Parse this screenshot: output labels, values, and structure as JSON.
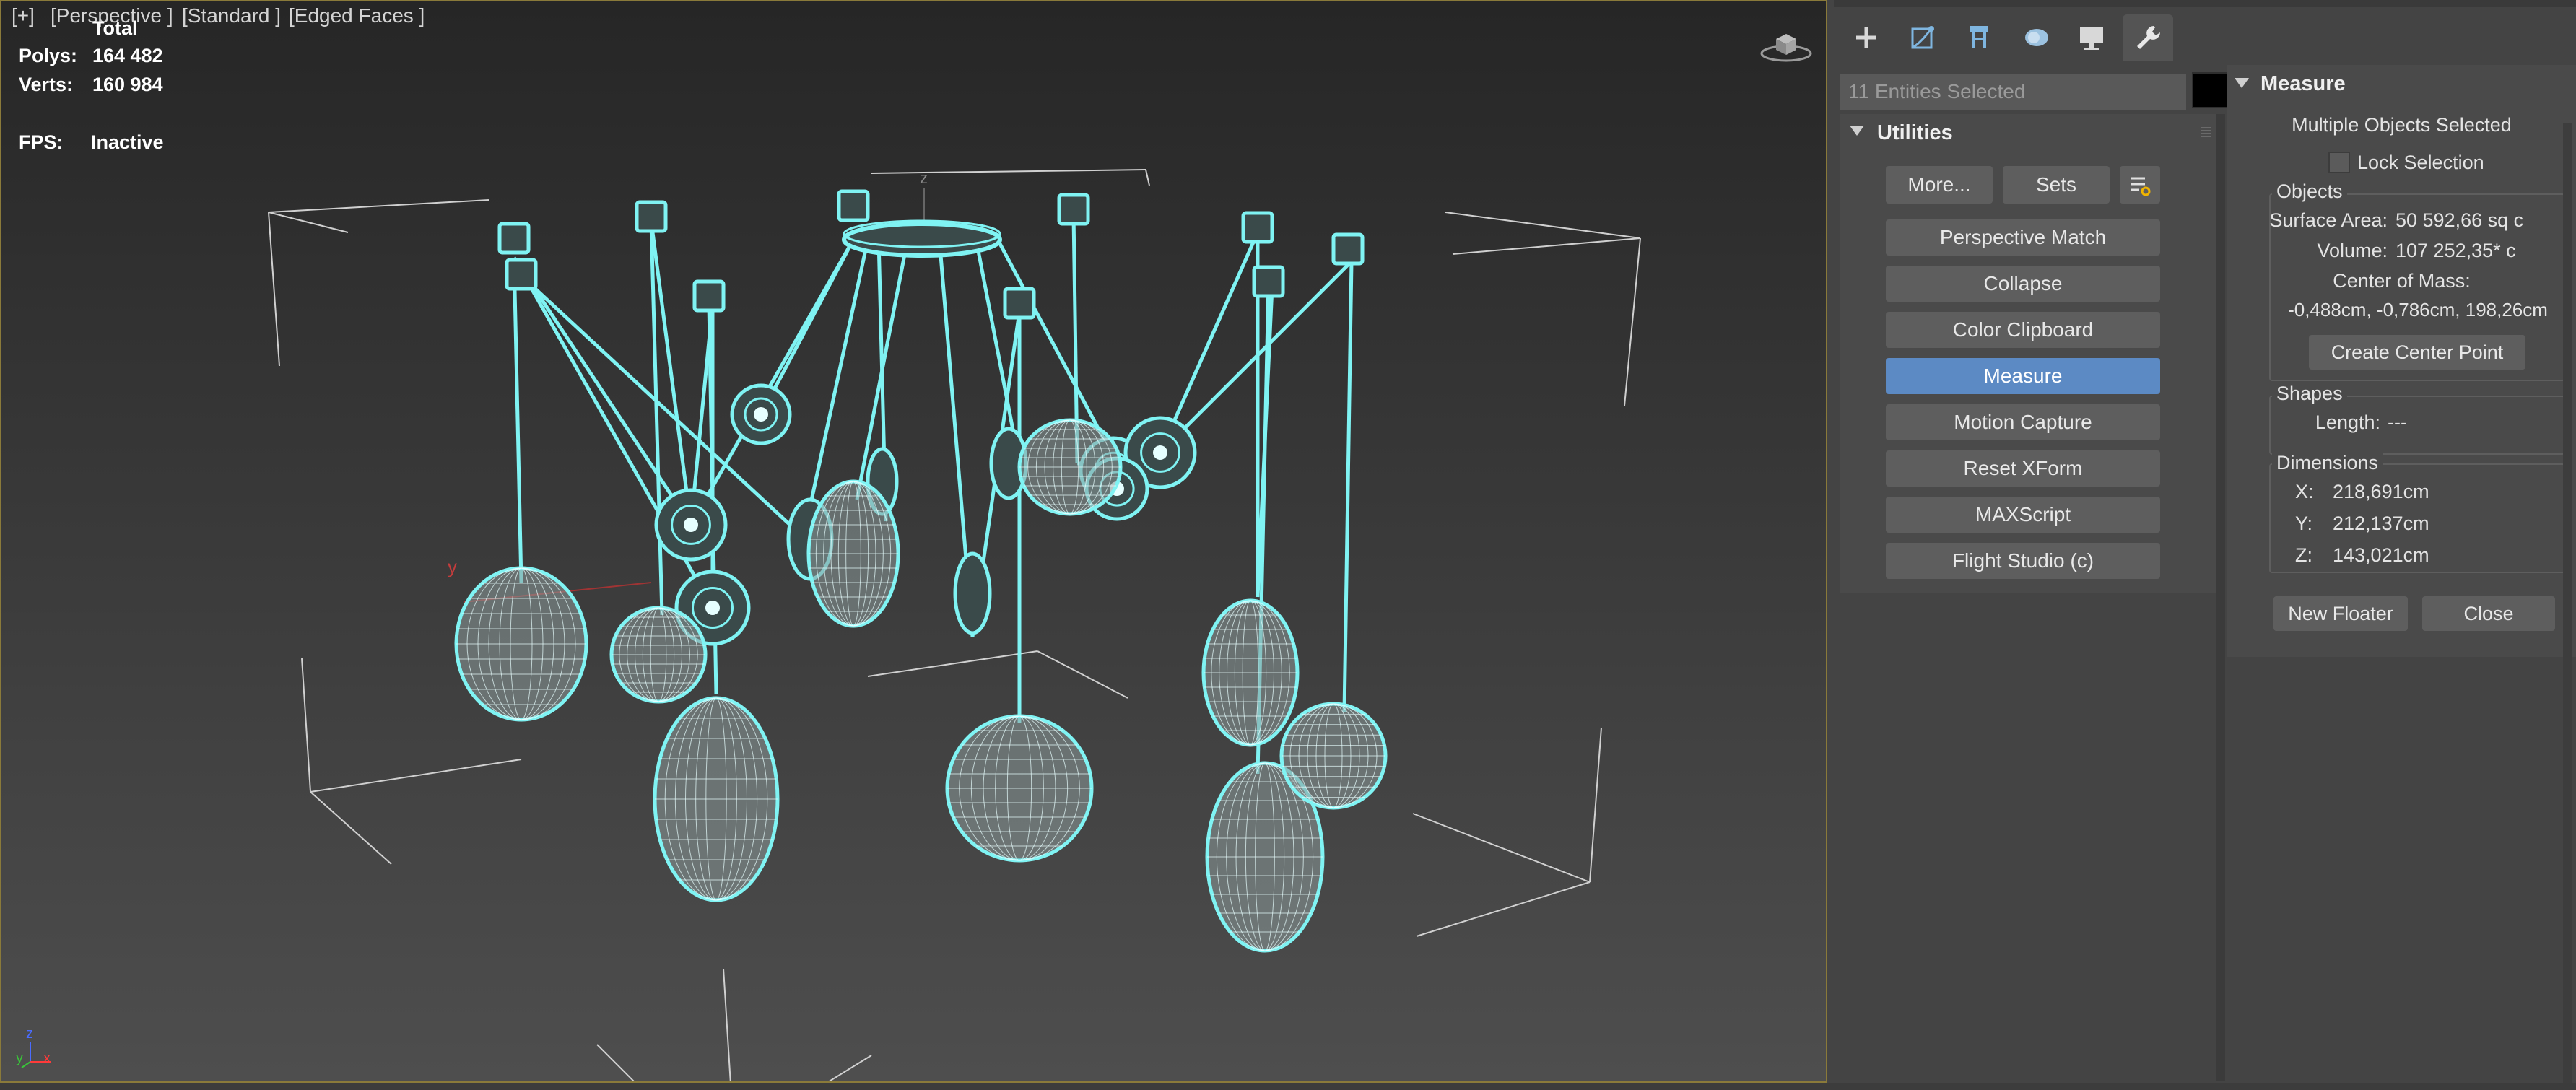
{
  "viewport": {
    "label_plus": "[+]",
    "label_view": "[Perspective ]",
    "label_shading": "[Standard ]",
    "label_mode": "[Edged Faces ]",
    "stats": {
      "total_label": "Total",
      "polys_label": "Polys:",
      "polys_value": "164 482",
      "verts_label": "Verts:",
      "verts_value": "160 984",
      "fps_label": "FPS:",
      "fps_value": "Inactive"
    },
    "axis_y_label": "y",
    "axis_z_label": "z",
    "tripod": {
      "z": "z",
      "y": "y",
      "x": "x"
    },
    "wire_color": "#7ff3f3",
    "icons": [
      "viewcube-icon",
      "axis-tripod-icon"
    ]
  },
  "command_panel": {
    "tabs": [
      {
        "name": "create-tab",
        "icon": "plus-icon"
      },
      {
        "name": "modify-tab",
        "icon": "modify-icon"
      },
      {
        "name": "hierarchy-tab",
        "icon": "hierarchy-icon"
      },
      {
        "name": "motion-tab",
        "icon": "motion-icon"
      },
      {
        "name": "display-tab",
        "icon": "display-icon"
      },
      {
        "name": "utilities-tab",
        "icon": "wrench-icon",
        "active": true
      }
    ],
    "selection_field": "11 Entities Selected",
    "swatch_color": "#000000"
  },
  "utilities": {
    "title": "Utilities",
    "more_label": "More...",
    "sets_label": "Sets",
    "buttons": [
      "Perspective Match",
      "Collapse",
      "Color Clipboard",
      "Measure",
      "Motion Capture",
      "Reset XForm",
      "MAXScript",
      "Flight Studio (c)"
    ],
    "active_button": "Measure",
    "accent_color": "#5c8ac4"
  },
  "measure": {
    "title": "Measure",
    "selection_status": "Multiple Objects Selected",
    "lock_selection": "Lock Selection",
    "objects": {
      "title": "Objects",
      "surface_area_label": "Surface Area:",
      "surface_area_value": "50 592,66 sq c",
      "volume_label": "Volume:",
      "volume_value": "107 252,35* c",
      "center_label": "Center of Mass:",
      "center_value": "-0,488cm, -0,786cm, 198,26cm",
      "create_center_label": "Create Center Point"
    },
    "shapes": {
      "title": "Shapes",
      "length_label": "Length:",
      "length_value": "---"
    },
    "dimensions": {
      "title": "Dimensions",
      "x_label": "X:",
      "x_value": "218,691cm",
      "y_label": "Y:",
      "y_value": "212,137cm",
      "z_label": "Z:",
      "z_value": "143,021cm"
    },
    "new_floater_label": "New Floater",
    "close_label": "Close"
  }
}
